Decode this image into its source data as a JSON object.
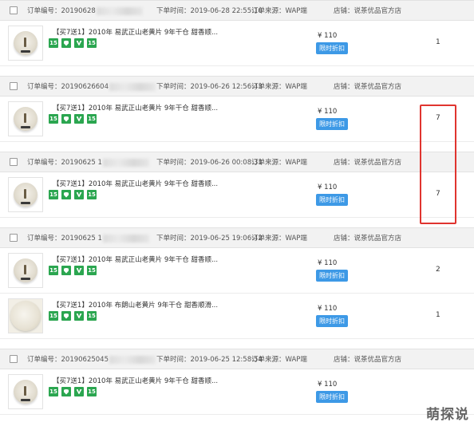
{
  "labels": {
    "order_no": "订单编号：",
    "order_time": "下单时间：",
    "source": "订单来源：",
    "store": "店铺："
  },
  "orders": [
    {
      "id_prefix": "20190628",
      "time": "2019-06-28 22:55:16",
      "source": "WAP端",
      "store": "说茶优品官方店",
      "items": [
        {
          "title": "【买7送1】2010年 易武正山老黄片 9年干仓 甜香顺...",
          "price": "¥ 110",
          "promo": "限时折扣",
          "qty": "1"
        }
      ]
    },
    {
      "id_prefix": "20190626604",
      "time": "2019-06-26 12:56:43",
      "source": "WAP端",
      "store": "说茶优品官方店",
      "items": [
        {
          "title": "【买7送1】2010年 易武正山老黄片 9年干仓 甜香顺...",
          "price": "¥ 110",
          "promo": "限时折扣",
          "qty": "7"
        }
      ]
    },
    {
      "id_prefix": "20190625 1",
      "time": "2019-06-26 00:08:31",
      "source": "WAP端",
      "store": "说茶优品官方店",
      "items": [
        {
          "title": "【买7送1】2010年 易武正山老黄片 9年干仓 甜香顺...",
          "price": "¥ 110",
          "promo": "限时折扣",
          "qty": "7"
        }
      ]
    },
    {
      "id_prefix": "20190625 1",
      "time": "2019-06-25 19:06:42",
      "source": "WAP端",
      "store": "说茶优品官方店",
      "items": [
        {
          "title": "【买7送1】2010年 易武正山老黄片 9年干仓 甜香顺...",
          "price": "¥ 110",
          "promo": "限时折扣",
          "qty": "2"
        },
        {
          "title": "【买7送1】2010年 布朗山老黄片 9年干仓 甜香顺滑...",
          "price": "¥ 110",
          "promo": "限时折扣",
          "qty": "1"
        }
      ]
    },
    {
      "id_prefix": "20190625045",
      "time": "2019-06-25 12:58:54",
      "source": "WAP端",
      "store": "说茶优品官方店",
      "items": [
        {
          "title": "【买7送1】2010年 易武正山老黄片 9年干仓 甜香顺...",
          "price": "¥ 110",
          "promo": "限时折扣",
          "qty": ""
        }
      ]
    }
  ],
  "badges": [
    "15",
    "shield",
    "v",
    "15"
  ],
  "watermark": "萌探说",
  "colors": {
    "promo": "#3d99e6",
    "badge": "#2ba650",
    "highlight": "#e0342f"
  }
}
